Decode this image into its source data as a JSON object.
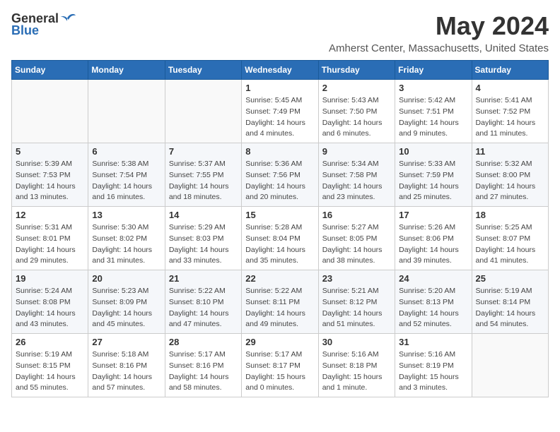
{
  "header": {
    "logo_general": "General",
    "logo_blue": "Blue",
    "month_title": "May 2024",
    "location": "Amherst Center, Massachusetts, United States"
  },
  "weekdays": [
    "Sunday",
    "Monday",
    "Tuesday",
    "Wednesday",
    "Thursday",
    "Friday",
    "Saturday"
  ],
  "weeks": [
    [
      {
        "day": "",
        "info": ""
      },
      {
        "day": "",
        "info": ""
      },
      {
        "day": "",
        "info": ""
      },
      {
        "day": "1",
        "info": "Sunrise: 5:45 AM\nSunset: 7:49 PM\nDaylight: 14 hours\nand 4 minutes."
      },
      {
        "day": "2",
        "info": "Sunrise: 5:43 AM\nSunset: 7:50 PM\nDaylight: 14 hours\nand 6 minutes."
      },
      {
        "day": "3",
        "info": "Sunrise: 5:42 AM\nSunset: 7:51 PM\nDaylight: 14 hours\nand 9 minutes."
      },
      {
        "day": "4",
        "info": "Sunrise: 5:41 AM\nSunset: 7:52 PM\nDaylight: 14 hours\nand 11 minutes."
      }
    ],
    [
      {
        "day": "5",
        "info": "Sunrise: 5:39 AM\nSunset: 7:53 PM\nDaylight: 14 hours\nand 13 minutes."
      },
      {
        "day": "6",
        "info": "Sunrise: 5:38 AM\nSunset: 7:54 PM\nDaylight: 14 hours\nand 16 minutes."
      },
      {
        "day": "7",
        "info": "Sunrise: 5:37 AM\nSunset: 7:55 PM\nDaylight: 14 hours\nand 18 minutes."
      },
      {
        "day": "8",
        "info": "Sunrise: 5:36 AM\nSunset: 7:56 PM\nDaylight: 14 hours\nand 20 minutes."
      },
      {
        "day": "9",
        "info": "Sunrise: 5:34 AM\nSunset: 7:58 PM\nDaylight: 14 hours\nand 23 minutes."
      },
      {
        "day": "10",
        "info": "Sunrise: 5:33 AM\nSunset: 7:59 PM\nDaylight: 14 hours\nand 25 minutes."
      },
      {
        "day": "11",
        "info": "Sunrise: 5:32 AM\nSunset: 8:00 PM\nDaylight: 14 hours\nand 27 minutes."
      }
    ],
    [
      {
        "day": "12",
        "info": "Sunrise: 5:31 AM\nSunset: 8:01 PM\nDaylight: 14 hours\nand 29 minutes."
      },
      {
        "day": "13",
        "info": "Sunrise: 5:30 AM\nSunset: 8:02 PM\nDaylight: 14 hours\nand 31 minutes."
      },
      {
        "day": "14",
        "info": "Sunrise: 5:29 AM\nSunset: 8:03 PM\nDaylight: 14 hours\nand 33 minutes."
      },
      {
        "day": "15",
        "info": "Sunrise: 5:28 AM\nSunset: 8:04 PM\nDaylight: 14 hours\nand 35 minutes."
      },
      {
        "day": "16",
        "info": "Sunrise: 5:27 AM\nSunset: 8:05 PM\nDaylight: 14 hours\nand 38 minutes."
      },
      {
        "day": "17",
        "info": "Sunrise: 5:26 AM\nSunset: 8:06 PM\nDaylight: 14 hours\nand 39 minutes."
      },
      {
        "day": "18",
        "info": "Sunrise: 5:25 AM\nSunset: 8:07 PM\nDaylight: 14 hours\nand 41 minutes."
      }
    ],
    [
      {
        "day": "19",
        "info": "Sunrise: 5:24 AM\nSunset: 8:08 PM\nDaylight: 14 hours\nand 43 minutes."
      },
      {
        "day": "20",
        "info": "Sunrise: 5:23 AM\nSunset: 8:09 PM\nDaylight: 14 hours\nand 45 minutes."
      },
      {
        "day": "21",
        "info": "Sunrise: 5:22 AM\nSunset: 8:10 PM\nDaylight: 14 hours\nand 47 minutes."
      },
      {
        "day": "22",
        "info": "Sunrise: 5:22 AM\nSunset: 8:11 PM\nDaylight: 14 hours\nand 49 minutes."
      },
      {
        "day": "23",
        "info": "Sunrise: 5:21 AM\nSunset: 8:12 PM\nDaylight: 14 hours\nand 51 minutes."
      },
      {
        "day": "24",
        "info": "Sunrise: 5:20 AM\nSunset: 8:13 PM\nDaylight: 14 hours\nand 52 minutes."
      },
      {
        "day": "25",
        "info": "Sunrise: 5:19 AM\nSunset: 8:14 PM\nDaylight: 14 hours\nand 54 minutes."
      }
    ],
    [
      {
        "day": "26",
        "info": "Sunrise: 5:19 AM\nSunset: 8:15 PM\nDaylight: 14 hours\nand 55 minutes."
      },
      {
        "day": "27",
        "info": "Sunrise: 5:18 AM\nSunset: 8:16 PM\nDaylight: 14 hours\nand 57 minutes."
      },
      {
        "day": "28",
        "info": "Sunrise: 5:17 AM\nSunset: 8:16 PM\nDaylight: 14 hours\nand 58 minutes."
      },
      {
        "day": "29",
        "info": "Sunrise: 5:17 AM\nSunset: 8:17 PM\nDaylight: 15 hours\nand 0 minutes."
      },
      {
        "day": "30",
        "info": "Sunrise: 5:16 AM\nSunset: 8:18 PM\nDaylight: 15 hours\nand 1 minute."
      },
      {
        "day": "31",
        "info": "Sunrise: 5:16 AM\nSunset: 8:19 PM\nDaylight: 15 hours\nand 3 minutes."
      },
      {
        "day": "",
        "info": ""
      }
    ]
  ]
}
